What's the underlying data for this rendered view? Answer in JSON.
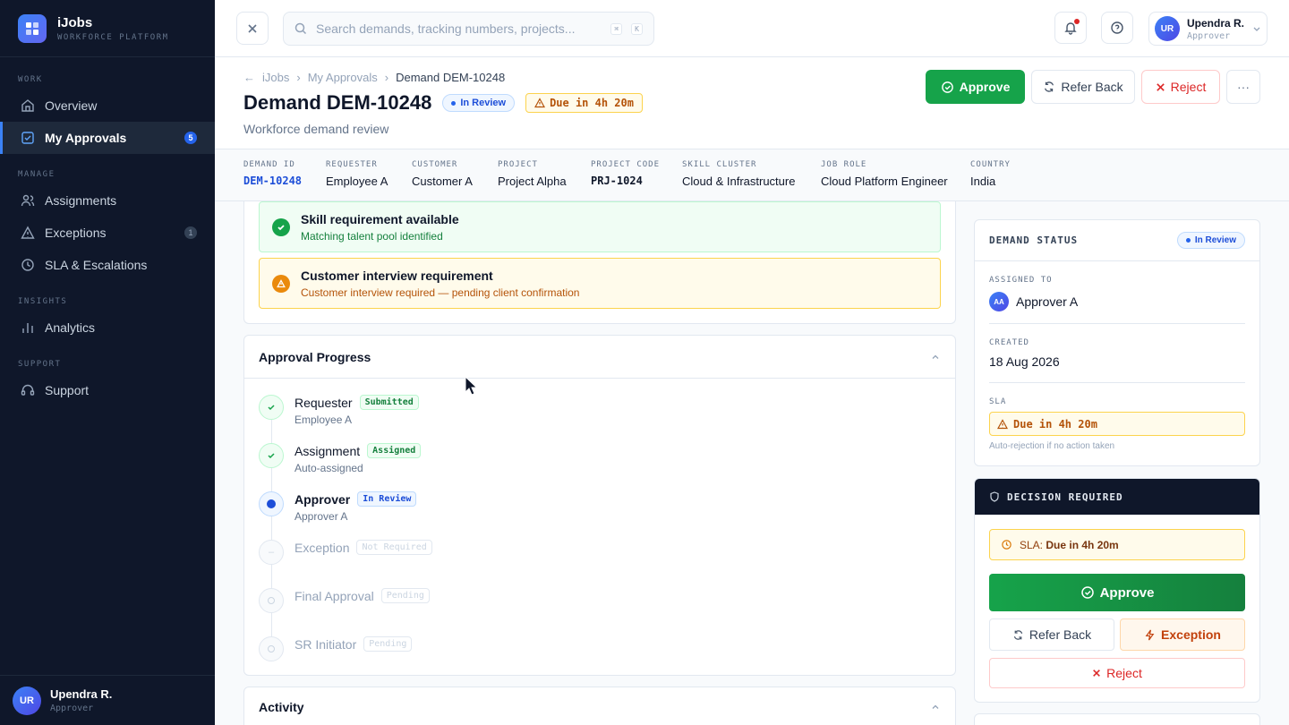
{
  "app": {
    "name": "iJobs",
    "tagline": "WORKFORCE PLATFORM"
  },
  "sidebar": {
    "sections": {
      "work": "WORK",
      "manage": "MANAGE",
      "insights": "INSIGHTS",
      "support": "SUPPORT"
    },
    "items": {
      "overview": "Overview",
      "approvals": "My Approvals",
      "approvals_count": "5",
      "assignments": "Assignments",
      "exceptions": "Exceptions",
      "exceptions_count": "1",
      "sla": "SLA & Escalations",
      "analytics": "Analytics",
      "support": "Support"
    },
    "user": {
      "initials": "UR",
      "name": "Upendra R.",
      "role": "Approver"
    }
  },
  "topbar": {
    "search_placeholder": "Search demands, tracking numbers, projects...",
    "kbd_1": "⌘",
    "kbd_2": "K",
    "user": {
      "initials": "UR",
      "name": "Upendra R.",
      "role": "Approver"
    }
  },
  "header": {
    "breadcrumb": {
      "root": "iJobs",
      "parent": "My Approvals",
      "current": "Demand DEM-10248"
    },
    "title": "Demand DEM-10248",
    "status": "In Review",
    "due": "Due in 4h 20m",
    "subtitle": "Workforce demand review",
    "actions": {
      "approve": "Approve",
      "refer_back": "Refer Back",
      "reject": "Reject",
      "more": "···"
    }
  },
  "meta": [
    {
      "label": "DEMAND ID",
      "value": "DEM-10248"
    },
    {
      "label": "REQUESTER",
      "value": "Employee A"
    },
    {
      "label": "CUSTOMER",
      "value": "Customer A"
    },
    {
      "label": "PROJECT",
      "value": "Project Alpha"
    },
    {
      "label": "PROJECT CODE",
      "value": "PRJ-1024"
    },
    {
      "label": "SKILL CLUSTER",
      "value": "Cloud & Infrastructure"
    },
    {
      "label": "JOB ROLE",
      "value": "Cloud Platform Engineer"
    },
    {
      "label": "COUNTRY",
      "value": "India"
    }
  ],
  "checks": [
    {
      "title": "Skill requirement available",
      "sub": "Matching talent pool identified"
    },
    {
      "title": "Customer interview requirement",
      "sub": "Customer interview required — pending client confirmation"
    }
  ],
  "progress": {
    "title": "Approval Progress",
    "steps": [
      {
        "name": "Requester",
        "tag": "Submitted",
        "sub": "Employee A"
      },
      {
        "name": "Assignment",
        "tag": "Assigned",
        "sub": "Auto-assigned"
      },
      {
        "name": "Approver",
        "tag": "In Review",
        "sub": "Approver A"
      },
      {
        "name": "Exception",
        "tag": "Not Required",
        "sub": ""
      },
      {
        "name": "Final Approval",
        "tag": "Pending",
        "sub": ""
      },
      {
        "name": "SR Initiator",
        "tag": "Pending",
        "sub": ""
      }
    ]
  },
  "activity": {
    "title": "Activity"
  },
  "status_panel": {
    "title": "DEMAND STATUS",
    "status": "In Review",
    "assigned_label": "ASSIGNED TO",
    "assigned_initials": "AA",
    "assigned_value": "Approver A",
    "created_label": "CREATED",
    "created_value": "18 Aug 2026",
    "sla_label": "SLA",
    "sla_value": "Due in 4h 20m",
    "sla_note": "Auto-rejection if no action taken"
  },
  "decision": {
    "title": "DECISION REQUIRED",
    "sla_prefix": "SLA:",
    "sla_value": "Due in 4h 20m",
    "approve": "Approve",
    "refer_back": "Refer Back",
    "exception": "Exception",
    "reject": "Reject"
  }
}
